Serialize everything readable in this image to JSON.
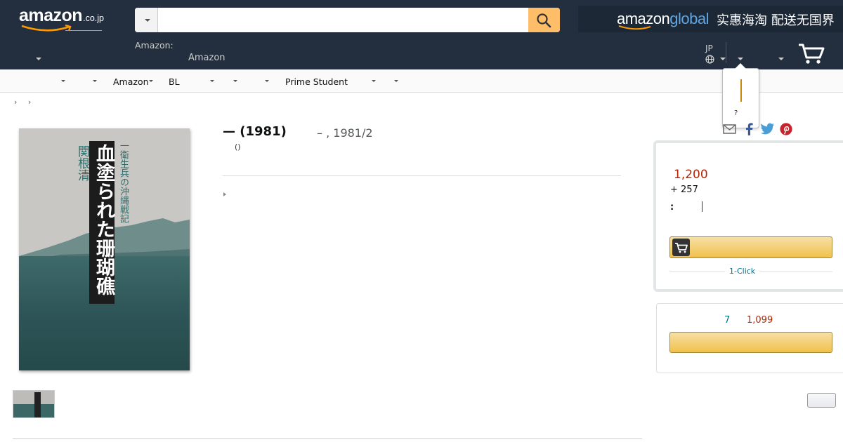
{
  "header": {
    "logo_word": "amazon",
    "logo_tld": ".co.jp",
    "search": {
      "value": "",
      "placeholder": ""
    },
    "global_word": "amazon",
    "global_word_accent": "global",
    "global_cn": "实惠海淘 配送无国界",
    "line1": "Amazon:",
    "line2": "Amazon",
    "locale": "JP"
  },
  "subnav": {
    "items": [
      "Amazon",
      "BL",
      "Prime Student"
    ]
  },
  "popover": {
    "question": "?"
  },
  "breadcrumb": "› ›",
  "book": {
    "title": "— (1981)",
    "meta": "– , 1981/2",
    "format": "()",
    "cover_title": "血塗られた珊瑚礁",
    "cover_subtitle": "一衛生兵の沖縄戦記",
    "cover_author": "関根清"
  },
  "buybox": {
    "price": "1,200",
    "shipping": "+ 257",
    "delivery_label": ":",
    "one_click": "1-Click"
  },
  "used": {
    "count": "7",
    "price": "1,099"
  },
  "colors": {
    "header_bg": "#232f3e",
    "search_button": "#febd69",
    "price_red": "#b12704",
    "link_teal": "#007185",
    "button_gold": "#f0c14b"
  }
}
